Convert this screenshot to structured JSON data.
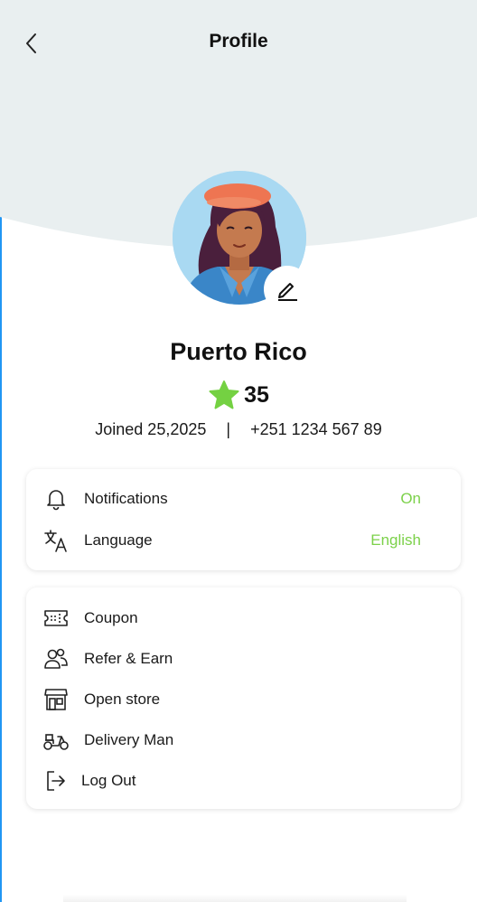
{
  "header": {
    "title": "Profile",
    "background_color": "#e9eff0"
  },
  "profile": {
    "name": "Puerto Rico",
    "rating": "35",
    "joined": "Joined 25,2025",
    "separator": "|",
    "phone": "+251 1234 567 89"
  },
  "colors": {
    "accent_green": "#7cd14a",
    "star_green": "#74d142",
    "avatar_bg": "#a9d9f2"
  },
  "settings": [
    {
      "label": "Notifications",
      "value": "On",
      "icon": "bell-icon"
    },
    {
      "label": "Language",
      "value": "English",
      "icon": "translate-icon"
    }
  ],
  "menu": [
    {
      "label": "Coupon",
      "icon": "ticket-icon"
    },
    {
      "label": "Refer & Earn",
      "icon": "users-icon"
    },
    {
      "label": "Open store",
      "icon": "store-icon"
    },
    {
      "label": "Delivery Man",
      "icon": "scooter-icon"
    },
    {
      "label": "Log Out",
      "icon": "logout-icon"
    }
  ]
}
